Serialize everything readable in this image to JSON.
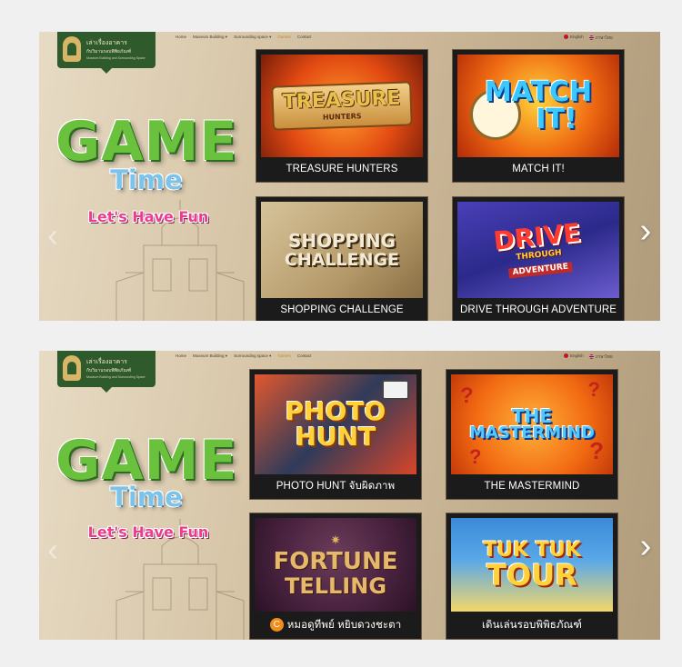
{
  "site": {
    "logo": {
      "title": "เล่าเรื่องอาคาร",
      "subtitle": "กับวิมานรอบพิพิธภัณฑ์",
      "tagline": "Museum Building and Surrounding Space"
    },
    "nav": [
      "Home",
      "Museum Building",
      "Surrounding space",
      "Games",
      "Contact"
    ],
    "lang": [
      "English",
      "ภาษาไทย"
    ]
  },
  "hero": {
    "line1": "GAME",
    "line2": "Time",
    "line3": "Let's Have Fun"
  },
  "slides": [
    {
      "games": [
        {
          "caption": "TREASURE HUNTERS",
          "art": [
            "TREASURE",
            "HUNTERS"
          ]
        },
        {
          "caption": "MATCH IT!",
          "art": [
            "MATCH",
            "IT!"
          ]
        },
        {
          "caption": "SHOPPING CHALLENGE",
          "art": [
            "SHOPPING",
            "CHALLENGE"
          ]
        },
        {
          "caption": "DRIVE THROUGH ADVENTURE",
          "art": [
            "DRIVE",
            "THROUGH",
            "ADVENTURE"
          ]
        }
      ]
    },
    {
      "games": [
        {
          "caption": "PHOTO HUNT จับผิดภาพ",
          "art": [
            "PHOTO",
            "HUNT"
          ]
        },
        {
          "caption": "THE MASTERMIND",
          "art": [
            "THE",
            "MASTERMIND"
          ]
        },
        {
          "caption": "หมอดูทีพย์ หยิบดวงชะตา",
          "art": [
            "FORTUNE",
            "TELLING"
          ]
        },
        {
          "caption": "เดินเล่นรอบพิพิธภัณฑ์",
          "art": [
            "TUK TUK",
            "TOUR"
          ]
        }
      ]
    }
  ],
  "controls": {
    "prev": "‹",
    "next": "›",
    "badge": "C"
  }
}
